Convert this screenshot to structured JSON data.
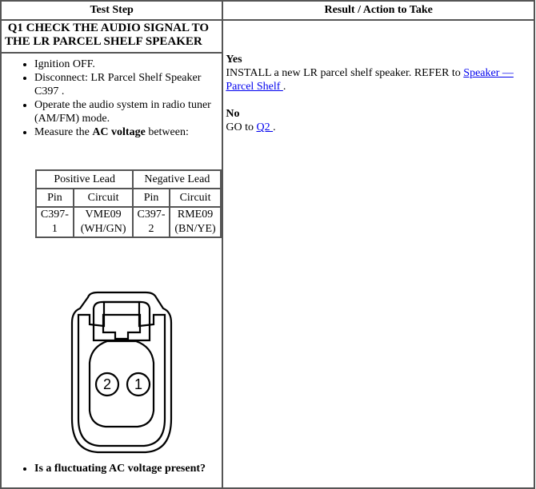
{
  "headers": {
    "test_step": "Test Step",
    "result_action": "Result / Action to Take"
  },
  "step": {
    "title": "Q1 CHECK THE AUDIO SIGNAL TO THE LR PARCEL SHELF SPEAKER",
    "bullets": [
      "Ignition OFF.",
      "Disconnect: LR Parcel Shelf Speaker C397 .",
      "Operate the audio system in radio tuner (AM/FM) mode."
    ],
    "measure_prefix": "Measure the ",
    "measure_bold": "AC voltage",
    "measure_suffix": " between:",
    "question": "Is a fluctuating AC voltage present?"
  },
  "pin_table": {
    "positive_lead": "Positive Lead",
    "negative_lead": "Negative Lead",
    "pin_label": "Pin",
    "circuit_label": "Circuit",
    "positive_pin_line1": "C397-",
    "positive_pin_line2": "1",
    "positive_circuit_line1": "VME09",
    "positive_circuit_line2": "(WH/GN)",
    "negative_pin_line1": "C397-",
    "negative_pin_line2": "2",
    "negative_circuit_line1": "RME09",
    "negative_circuit_line2": "(BN/YE)"
  },
  "connector": {
    "pin_left": "2",
    "pin_right": "1"
  },
  "result": {
    "yes_label": "Yes",
    "yes_text": "INSTALL a new LR parcel shelf speaker. REFER to ",
    "yes_link": "Speaker — Parcel Shelf ",
    "yes_end": ".",
    "no_label": "No",
    "no_text": "GO to ",
    "no_link": "Q2 ",
    "no_end": "."
  },
  "colors": {
    "link": "#0000ee",
    "border": "#555555"
  }
}
